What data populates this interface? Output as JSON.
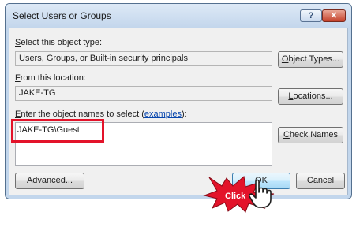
{
  "dialog": {
    "title": "Select Users or Groups",
    "help_glyph": "?",
    "close_glyph": "✕"
  },
  "object_type": {
    "label_prefix": "",
    "label_underlined": "S",
    "label_rest": "elect this object type:",
    "value": "Users, Groups, or Built-in security principals",
    "button_underlined": "O",
    "button_rest": "bject Types..."
  },
  "location": {
    "label_underlined": "F",
    "label_rest": "rom this location:",
    "value": "JAKE-TG",
    "button_underlined": "L",
    "button_rest": "ocations..."
  },
  "names": {
    "label_underlined": "E",
    "label_rest": "nter the object names to select (",
    "link": "examples",
    "label_end": "):",
    "value": "JAKE-TG\\Guest",
    "check_underlined": "C",
    "check_rest": "heck Names"
  },
  "footer": {
    "advanced_underlined": "A",
    "advanced_rest": "dvanced...",
    "ok_label": "OK",
    "cancel_label": "Cancel"
  },
  "overlay": {
    "click_label": "Click",
    "accent": "#e3132a"
  }
}
